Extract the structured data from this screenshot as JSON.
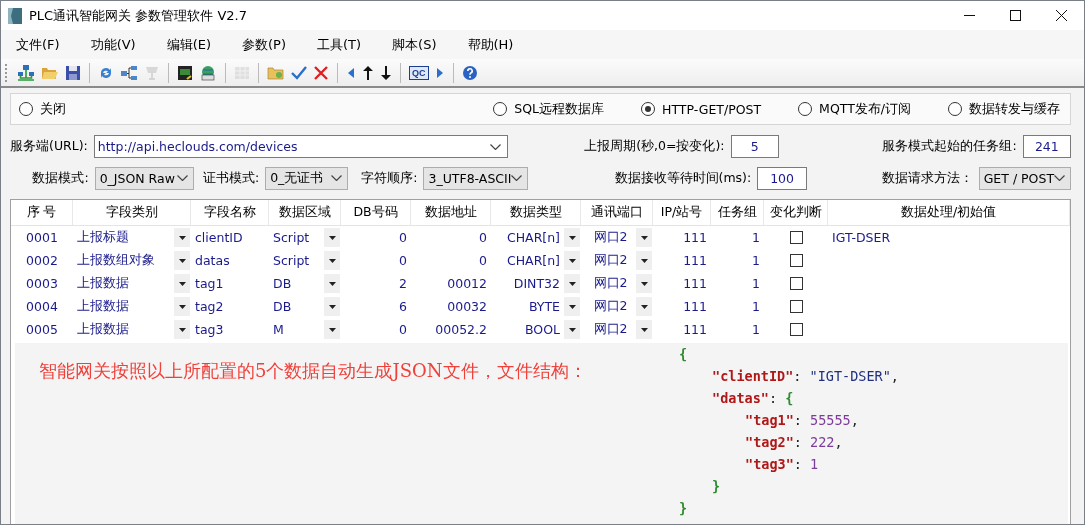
{
  "window": {
    "title": "PLC通讯智能网关 参数管理软件 V2.7"
  },
  "menu": [
    "文件(F)",
    "功能(V)",
    "编辑(E)",
    "参数(P)",
    "工具(T)",
    "脚本(S)",
    "帮助(H)"
  ],
  "toolbar": [
    {
      "kind": "network",
      "disabled": false
    },
    {
      "kind": "open",
      "disabled": false
    },
    {
      "kind": "save",
      "disabled": false
    },
    {
      "kind": "sep"
    },
    {
      "kind": "refresh",
      "disabled": false
    },
    {
      "kind": "tree",
      "disabled": false
    },
    {
      "kind": "plug",
      "disabled": true
    },
    {
      "kind": "sep"
    },
    {
      "kind": "monitor",
      "disabled": false
    },
    {
      "kind": "globe",
      "disabled": false
    },
    {
      "kind": "sep"
    },
    {
      "kind": "grid",
      "disabled": true
    },
    {
      "kind": "sep"
    },
    {
      "kind": "folder",
      "disabled": false
    },
    {
      "kind": "check",
      "disabled": false
    },
    {
      "kind": "cross",
      "disabled": false
    },
    {
      "kind": "sep"
    },
    {
      "kind": "left",
      "disabled": false
    },
    {
      "kind": "up",
      "disabled": false
    },
    {
      "kind": "down",
      "disabled": false
    },
    {
      "kind": "sep"
    },
    {
      "kind": "qc",
      "text": "QC",
      "disabled": false
    },
    {
      "kind": "right",
      "disabled": false
    },
    {
      "kind": "sep"
    },
    {
      "kind": "help",
      "disabled": false
    }
  ],
  "modes": [
    {
      "label": "关闭",
      "selected": false
    },
    {
      "label": "SQL远程数据库",
      "selected": false
    },
    {
      "label": "HTTP-GET/POST",
      "selected": true
    },
    {
      "label": "MQTT发布/订阅",
      "selected": false
    },
    {
      "label": "数据转发与缓存",
      "selected": false
    }
  ],
  "settings": {
    "url": {
      "label": "服务端(URL):",
      "value": "http://api.heclouds.com/devices"
    },
    "report_period": {
      "label": "上报周期(秒,0=按变化):",
      "value": "5"
    },
    "start_task_group": {
      "label": "服务模式起始的任务组:",
      "value": "241"
    },
    "data_mode": {
      "label": "数据模式:",
      "value": "0_JSON Raw"
    },
    "cert_mode": {
      "label": "证书模式:",
      "value": "0_无证书"
    },
    "char_order": {
      "label": "字符顺序:",
      "value": "3_UTF8-ASCII"
    },
    "receive_timeout": {
      "label": "数据接收等待时间(ms):",
      "value": "100"
    },
    "request_method": {
      "label": "数据请求方法：",
      "value": "GET / POST"
    }
  },
  "table": {
    "columns": [
      "序 号",
      "字段类别",
      "字段名称",
      "数据区域",
      "DB号码",
      "数据地址",
      "数据类型",
      "通讯端口",
      "IP/站号",
      "任务组",
      "变化判断",
      "数据处理/初始值"
    ],
    "rows": [
      {
        "index": "0001",
        "category": "上报标题",
        "name": "clientID",
        "area": "Script",
        "db": "0",
        "address": "0",
        "type": "CHAR[n]",
        "port": "网口2",
        "station": "111",
        "task_group": "1",
        "change_check": false,
        "value": "IGT-DSER"
      },
      {
        "index": "0002",
        "category": "上报数组对象",
        "name": "datas",
        "area": "Script",
        "db": "0",
        "address": "0",
        "type": "CHAR[n]",
        "port": "网口2",
        "station": "111",
        "task_group": "1",
        "change_check": false
      },
      {
        "index": "0003",
        "category": "上报数据",
        "name": "tag1",
        "area": "DB",
        "db": "2",
        "address": "00012",
        "type": "DINT32",
        "port": "网口2",
        "station": "111",
        "task_group": "1",
        "change_check": false
      },
      {
        "index": "0004",
        "category": "上报数据",
        "name": "tag2",
        "area": "DB",
        "db": "6",
        "address": "00032",
        "type": "BYTE",
        "port": "网口2",
        "station": "111",
        "task_group": "1",
        "change_check": false
      },
      {
        "index": "0005",
        "category": "上报数据",
        "name": "tag3",
        "area": "M",
        "db": "0",
        "address": "00052.2",
        "type": "BOOL",
        "port": "网口2",
        "station": "111",
        "task_group": "1",
        "change_check": false
      }
    ]
  },
  "annotation": {
    "text": "智能网关按照以上所配置的5个数据自动生成JSON文件，文件结构：",
    "json": {
      "open": "{",
      "close": "}",
      "children": [
        {
          "key": "\"clientID\"",
          "colon": ": ",
          "value": "\"IGT-DSER\"",
          "kind": "string",
          "comma": ","
        },
        {
          "key": "\"datas\"",
          "colon": ": ",
          "open": "{",
          "close": "}",
          "children": [
            {
              "key": "\"tag1\"",
              "colon": ": ",
              "value": "55555",
              "kind": "number",
              "comma": ","
            },
            {
              "key": "\"tag2\"",
              "colon": ": ",
              "value": "222",
              "kind": "number",
              "comma": ","
            },
            {
              "key": "\"tag3\"",
              "colon": ": ",
              "value": "1",
              "kind": "number"
            }
          ]
        }
      ]
    }
  }
}
